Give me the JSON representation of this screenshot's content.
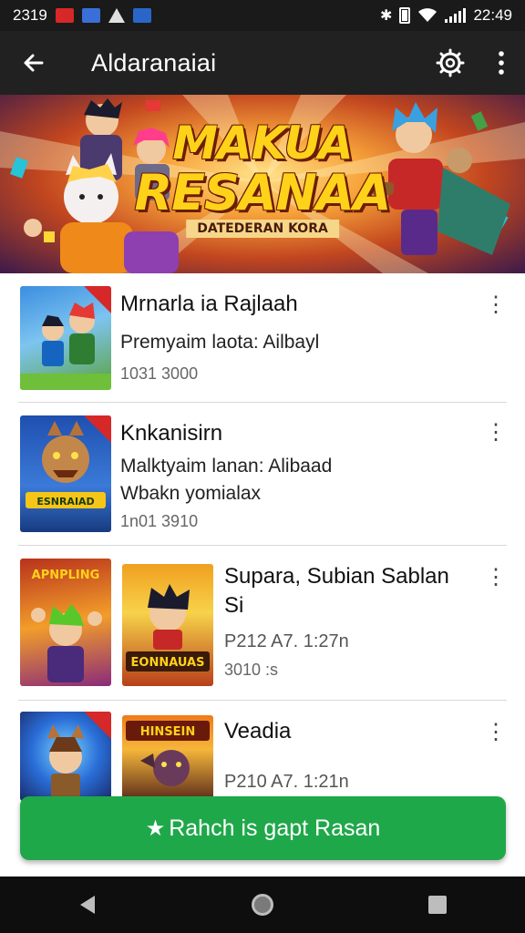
{
  "status_bar": {
    "time_left": "2319",
    "time_right": "22:49",
    "notification_icons": [
      "mail-icon",
      "message-icon",
      "warning-icon",
      "app-icon"
    ],
    "system_icons": [
      "bluetooth-icon",
      "battery-icon",
      "wifi-icon",
      "signal-icon"
    ]
  },
  "app_bar": {
    "title": "Aldaranaiai",
    "back_icon": "arrow-left-icon",
    "settings_icon": "gear-icon",
    "more_icon": "more-vertical-icon"
  },
  "banner": {
    "title_line1": "MAKUA",
    "title_line2": "RESANAA",
    "subtitle": "DATEDERAN KORA"
  },
  "list": {
    "items": [
      {
        "title": "Mrnarla ia Rajlaah",
        "line1": "Premyaim laota: Ailbayl",
        "meta": "1031 3000"
      },
      {
        "title": "Knkanisirn",
        "line1": "Malktyaim lanan: Alibaad",
        "line2": "Wbakn yomialax",
        "meta": "1n01 3910",
        "thumb_caption": "ESNRAIAD"
      },
      {
        "title": "Supara, Subian Sablan",
        "title2": "Si",
        "line1": "P212 A7. 1:27n",
        "meta": "3010 :s",
        "thumb1_caption": "APNPLING",
        "thumb2_caption": "EONNAUAS"
      },
      {
        "title": "Veadia",
        "line1": "P210 A7. 1:21n",
        "thumb2_caption": "HINSEIN"
      }
    ]
  },
  "action_button": {
    "label": "Rahch is gapt Rasan",
    "icon": "star-icon",
    "color": "#1fa84a"
  },
  "nav_bar": {
    "buttons": [
      "back-triangle-icon",
      "home-circle-icon",
      "recents-square-icon"
    ]
  }
}
